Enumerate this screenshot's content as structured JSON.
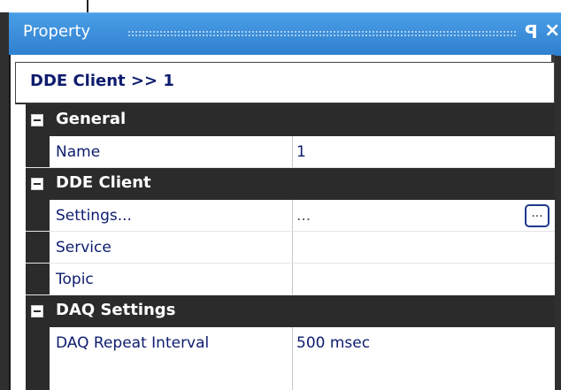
{
  "window": {
    "title": "Property",
    "pin_icon": "pin-icon",
    "close_icon": "close-icon"
  },
  "object": {
    "title": "DDE Client >> 1"
  },
  "categories": [
    {
      "label": "General",
      "properties": [
        {
          "name": "Name",
          "value": "1"
        }
      ]
    },
    {
      "label": "DDE Client",
      "properties": [
        {
          "name": "Settings...",
          "value": "...",
          "button": "..."
        },
        {
          "name": "Service",
          "value": ""
        },
        {
          "name": "Topic",
          "value": ""
        }
      ]
    },
    {
      "label": "DAQ Settings",
      "properties": [
        {
          "name": "DAQ Repeat Interval",
          "value": "500 msec"
        }
      ]
    }
  ]
}
